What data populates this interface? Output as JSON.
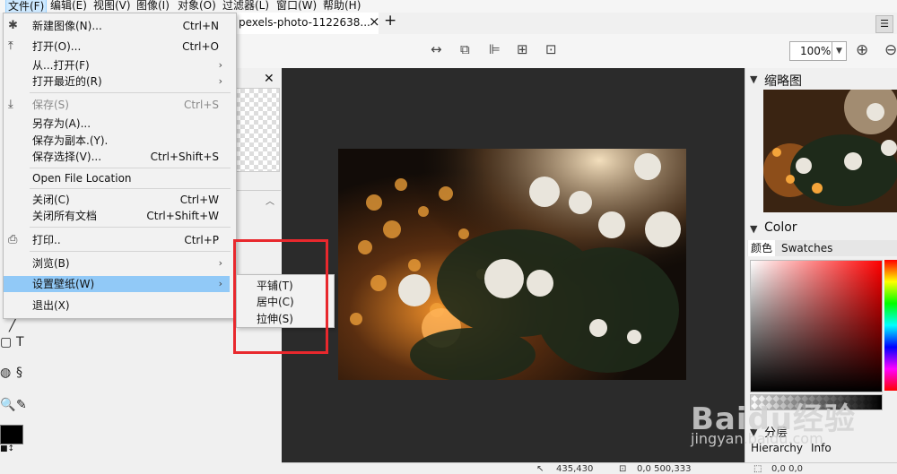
{
  "menubar": {
    "items": [
      "文件(F)",
      "编辑(E)",
      "视图(V)",
      "图像(I)",
      "对象(O)",
      "过滤器(L)",
      "窗口(W)",
      "帮助(H)"
    ]
  },
  "document_tab": {
    "title": "pexels-photo-1122638..."
  },
  "toolbar": {
    "zoom": "100%"
  },
  "file_menu": {
    "items": [
      {
        "label": "新建图像(N)...",
        "shortcut": "Ctrl+N",
        "icon": "new-image-icon"
      },
      {
        "label": "打开(O)...",
        "shortcut": "Ctrl+O",
        "icon": "open-icon"
      },
      {
        "label": "从...打开(F)",
        "submenu": true
      },
      {
        "label": "打开最近的(R)",
        "submenu": true
      },
      {
        "label": "保存(S)",
        "shortcut": "Ctrl+S",
        "disabled": true,
        "icon": "save-icon"
      },
      {
        "label": "另存为(A)..."
      },
      {
        "label": "保存为副本.(Y)."
      },
      {
        "label": "保存选择(V)...",
        "shortcut": "Ctrl+Shift+S"
      },
      {
        "label": "Open File Location"
      },
      {
        "label": "关闭(C)",
        "shortcut": "Ctrl+W"
      },
      {
        "label": "关闭所有文档",
        "shortcut": "Ctrl+Shift+W"
      },
      {
        "label": "打印..",
        "shortcut": "Ctrl+P",
        "icon": "print-icon"
      },
      {
        "label": "浏览(B)",
        "submenu": true
      },
      {
        "label": "设置壁纸(W)",
        "submenu": true,
        "highlighted": true
      },
      {
        "label": "退出(X)"
      }
    ]
  },
  "wallpaper_submenu": {
    "items": [
      "平铺(T)",
      "居中(C)",
      "拉伸(S)"
    ]
  },
  "right_panels": {
    "navigator_title": "缩略图",
    "color_title": "Color",
    "color_tabs": [
      "颜色",
      "Swatches"
    ],
    "layers_title": "分层",
    "layers_tabs": [
      "Hierarchy",
      "Info"
    ]
  },
  "status": {
    "cursor": "435,430",
    "image_size": "0,0 500,333",
    "selection": "0,0 0,0"
  },
  "watermark": {
    "main": "Baidu经验",
    "sub": "jingyan.baidu.com"
  },
  "colors": {
    "highlight": "#91c9f7",
    "annotation": "#e8282d",
    "canvas_bg": "#2b2b2b"
  }
}
